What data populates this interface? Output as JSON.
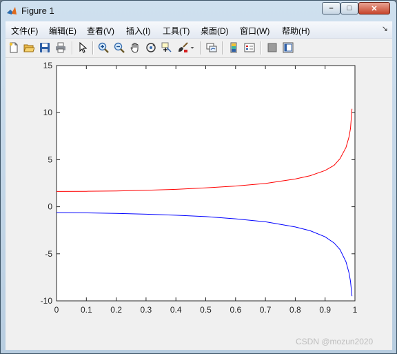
{
  "window": {
    "title": "Figure 1",
    "minimize": "–",
    "maximize": "□",
    "close": "✕"
  },
  "menubar": {
    "items": [
      {
        "label": "文件(F)"
      },
      {
        "label": "编辑(E)"
      },
      {
        "label": "查看(V)"
      },
      {
        "label": "插入(I)"
      },
      {
        "label": "工具(T)"
      },
      {
        "label": "桌面(D)"
      },
      {
        "label": "窗口(W)"
      },
      {
        "label": "帮助(H)"
      }
    ],
    "overflow": "↘"
  },
  "toolbar": {
    "buttons": [
      "new-figure",
      "open",
      "save",
      "print",
      "edit-plot-arrow",
      "zoom-in",
      "zoom-out",
      "pan",
      "rotate-3d",
      "data-cursor",
      "brush",
      "link-plot",
      "colorbar",
      "legend",
      "hide-plot-tools",
      "show-plot-tools"
    ]
  },
  "chart_data": {
    "type": "line",
    "title": "",
    "xlabel": "",
    "ylabel": "",
    "xlim": [
      0,
      1
    ],
    "ylim": [
      -10,
      15
    ],
    "xticks": [
      "0",
      "0.1",
      "0.2",
      "0.3",
      "0.4",
      "0.5",
      "0.6",
      "0.7",
      "0.8",
      "0.9",
      "1"
    ],
    "yticks": [
      "15",
      "10",
      "5",
      "0",
      "-5",
      "-10"
    ],
    "grid": false,
    "series": [
      {
        "color": "#ff0000",
        "x": [
          0,
          0.1,
          0.2,
          0.3,
          0.4,
          0.5,
          0.6,
          0.7,
          0.8,
          0.85,
          0.9,
          0.93,
          0.95,
          0.97,
          0.98,
          0.985,
          0.99
        ],
        "y": [
          1.63,
          1.64,
          1.68,
          1.75,
          1.85,
          2.0,
          2.2,
          2.47,
          2.95,
          3.3,
          3.85,
          4.4,
          5.1,
          6.3,
          7.4,
          8.3,
          10.4
        ]
      },
      {
        "color": "#0000ff",
        "x": [
          0,
          0.1,
          0.2,
          0.3,
          0.4,
          0.5,
          0.6,
          0.7,
          0.8,
          0.85,
          0.9,
          0.93,
          0.95,
          0.97,
          0.98,
          0.985,
          0.99
        ],
        "y": [
          -0.62,
          -0.65,
          -0.71,
          -0.79,
          -0.9,
          -1.05,
          -1.28,
          -1.6,
          -2.15,
          -2.55,
          -3.2,
          -3.85,
          -4.55,
          -5.85,
          -7.0,
          -7.9,
          -9.5
        ]
      }
    ]
  },
  "watermark": "CSDN @mozun2020"
}
